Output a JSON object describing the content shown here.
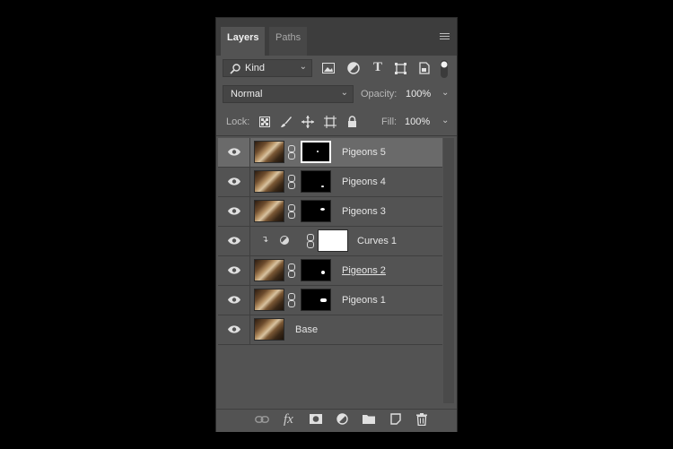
{
  "tabs": [
    {
      "label": "Layers"
    },
    {
      "label": "Paths"
    }
  ],
  "filter": {
    "kind_label": "Kind",
    "icons": [
      "image-filter-icon",
      "adjustment-filter-icon",
      "type-filter-icon",
      "shape-filter-icon",
      "smart-object-filter-icon",
      "filter-toggle-icon"
    ]
  },
  "blend": {
    "mode": "Normal",
    "opacity_label": "Opacity:",
    "opacity_value": "100%"
  },
  "lock": {
    "label": "Lock:",
    "fill_label": "Fill:",
    "fill_value": "100%"
  },
  "layers": [
    {
      "name": "Pigeons 5",
      "selected": true
    },
    {
      "name": "Pigeons 4"
    },
    {
      "name": "Pigeons 3"
    },
    {
      "name": "Curves 1"
    },
    {
      "name": "Pigeons 2"
    },
    {
      "name": "Pigeons 1"
    },
    {
      "name": "Base"
    }
  ],
  "bottom_icons": [
    "link-layers-icon",
    "fx-icon",
    "add-mask-icon",
    "new-adjustment-icon",
    "new-group-icon",
    "new-layer-icon",
    "delete-icon"
  ],
  "fx_label": "fx"
}
